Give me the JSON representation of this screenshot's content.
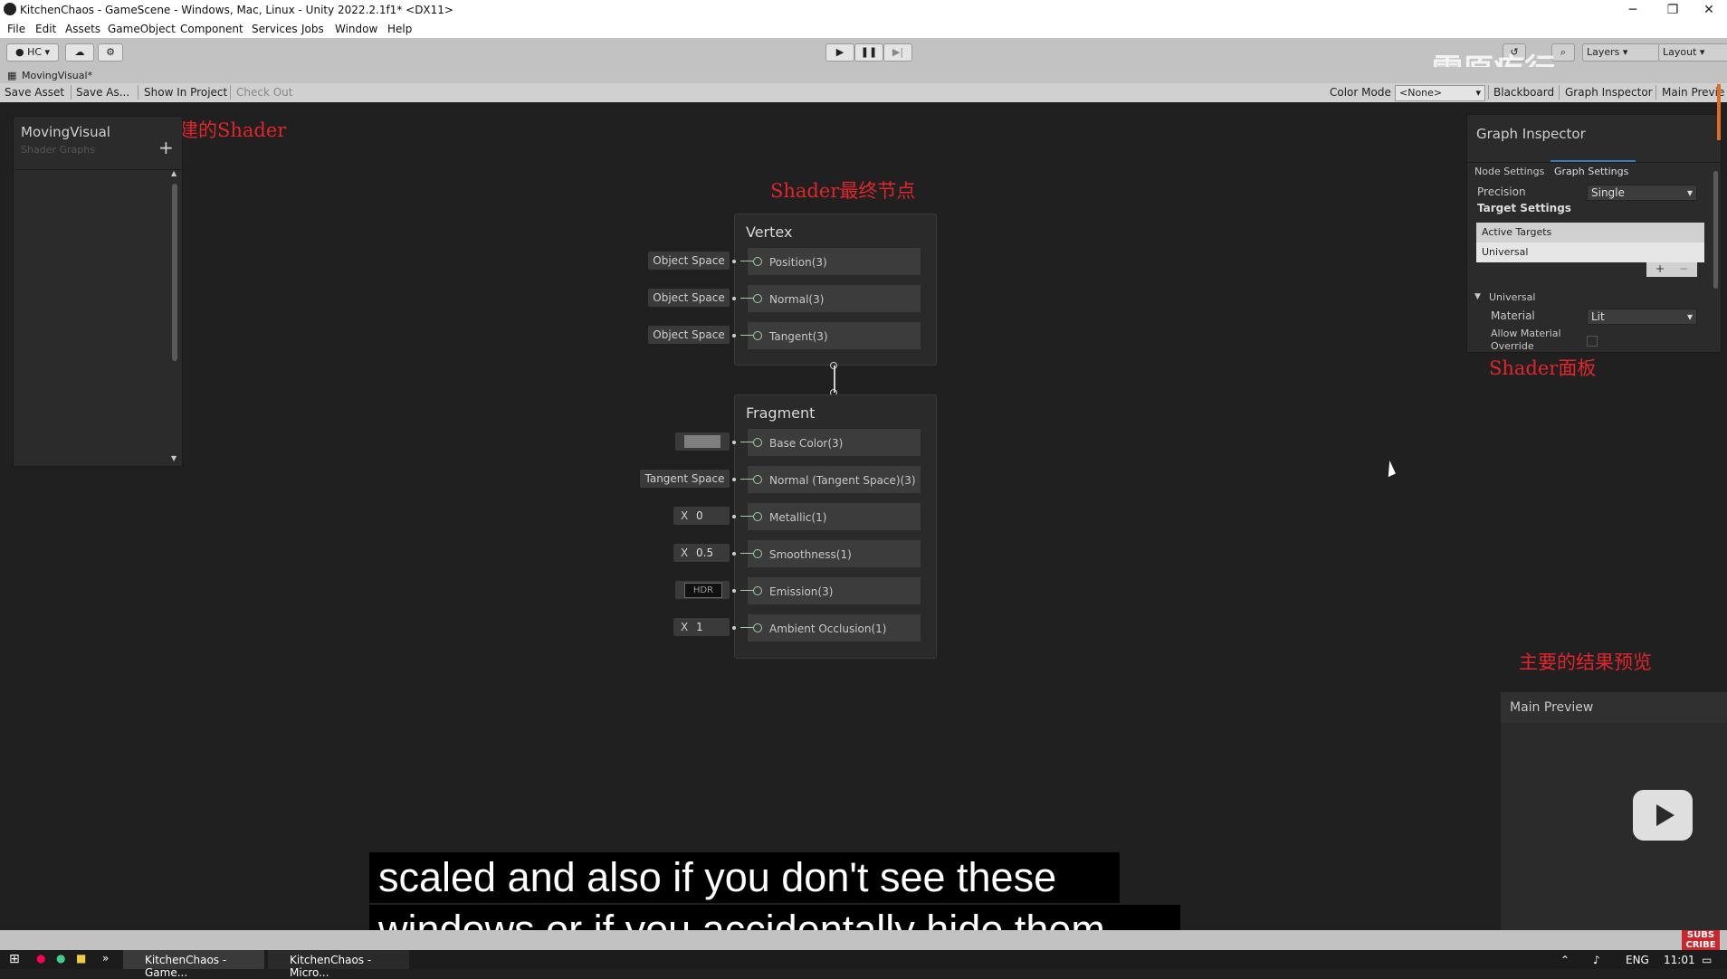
{
  "window": {
    "title": "KitchenChaos - GameScene - Windows, Mac, Linux - Unity 2022.2.1f1* <DX11>",
    "controls": [
      "─",
      "❐",
      "✕"
    ]
  },
  "menu": [
    "File",
    "Edit",
    "Assets",
    "GameObject",
    "Component",
    "Services",
    "Jobs",
    "Window",
    "Help"
  ],
  "toolbar": {
    "account": "HC",
    "layers_label": "Layers",
    "layout_label": "Layout"
  },
  "graph_tab": {
    "label": "MovingVisual*"
  },
  "graph_toolbar": {
    "save_asset": "Save Asset",
    "save_as": "Save As...",
    "show_in_project": "Show In Project",
    "check_out": "Check Out",
    "color_mode_label": "Color Mode",
    "color_mode_value": "<None>",
    "blackboard": "Blackboard",
    "graph_inspector": "Graph Inspector",
    "main_preview": "Main Previe"
  },
  "annotations": {
    "shader_created": "我们创建的Shader",
    "final_node": "Shader最终节点",
    "shader_panel": "Shader面板",
    "main_preview": "主要的结果预览"
  },
  "blackboard": {
    "title": "MovingVisual",
    "subtitle": "Shader Graphs",
    "add": "+"
  },
  "vertex": {
    "title": "Vertex",
    "slots": [
      {
        "label": "Position(3)",
        "input": "Object Space"
      },
      {
        "label": "Normal(3)",
        "input": "Object Space"
      },
      {
        "label": "Tangent(3)",
        "input": "Object Space"
      }
    ]
  },
  "fragment": {
    "title": "Fragment",
    "slots": [
      {
        "label": "Base Color(3)",
        "input": "",
        "kind": "color",
        "color": "#7f7f7f"
      },
      {
        "label": "Normal (Tangent Space)(3)",
        "input": "Tangent Space",
        "kind": "text"
      },
      {
        "label": "Metallic(1)",
        "axis": "X",
        "input": "0",
        "kind": "float"
      },
      {
        "label": "Smoothness(1)",
        "axis": "X",
        "input": "0.5",
        "kind": "float"
      },
      {
        "label": "Emission(3)",
        "input": "HDR",
        "kind": "hdr"
      },
      {
        "label": "Ambient Occlusion(1)",
        "axis": "X",
        "input": "1",
        "kind": "float"
      }
    ]
  },
  "inspector": {
    "title": "Graph Inspector",
    "tabs": [
      "Node Settings",
      "Graph Settings"
    ],
    "precision_label": "Precision",
    "precision_value": "Single",
    "target_settings": "Target Settings",
    "active_targets": "Active Targets",
    "target_item": "Universal",
    "universal_section": "Universal",
    "material_label": "Material",
    "material_value": "Lit",
    "allow_override_line1": "Allow Material",
    "allow_override_line2": "Override"
  },
  "preview": {
    "title": "Main Preview"
  },
  "watermark": "雪原疾行",
  "subtitles": [
    "scaled and also if you don't see these",
    "windows or if you accidentally hide them"
  ],
  "taskbar": {
    "app1": "KitchenChaos - Game...",
    "app2": "KitchenChaos - Micro...",
    "lang": "ENG",
    "time": "11:01"
  },
  "colors": {
    "accent_red": "#e0262c",
    "port_green": "#9ed0a5",
    "canvas": "#202020"
  }
}
